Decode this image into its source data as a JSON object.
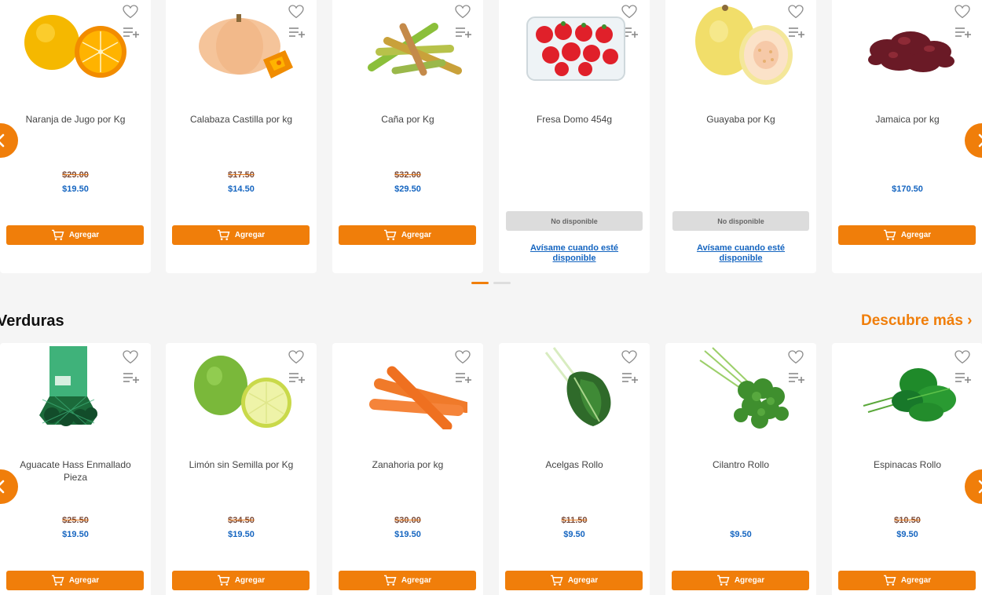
{
  "colors": {
    "accent": "#f07e0a",
    "price": "#1565c0",
    "unavailable": "#dcdcdc"
  },
  "icons": [
    "heart-icon",
    "list-add-icon",
    "cart-icon",
    "chevron-left-icon",
    "chevron-right-icon"
  ],
  "carousel1": {
    "products": [
      {
        "name": "Naranja de Jugo por Kg",
        "old_price": "$29.00",
        "price": "$19.50",
        "button": "Agregar"
      },
      {
        "name": "Calabaza Castilla por kg",
        "old_price": "$17.50",
        "price": "$14.50",
        "button": "Agregar"
      },
      {
        "name": "Caña por Kg",
        "old_price": "$32.00",
        "price": "$29.50",
        "button": "Agregar"
      },
      {
        "name": "Fresa Domo 454g",
        "unavailable": "No disponible",
        "notify_line1": "Avísame cuando esté",
        "notify_line2": "disponible"
      },
      {
        "name": "Guayaba por Kg",
        "unavailable": "No disponible",
        "notify_line1": "Avísame cuando esté",
        "notify_line2": "disponible"
      },
      {
        "name": "Jamaica por kg",
        "price": "$170.50",
        "button": "Agregar"
      }
    ]
  },
  "section2": {
    "title": "Verduras",
    "link": "Descubre más"
  },
  "carousel2": {
    "products": [
      {
        "name": "Aguacate Hass Enmallado Pieza",
        "old_price": "$25.50",
        "price": "$19.50",
        "button": "Agregar"
      },
      {
        "name": "Limón sin Semilla por Kg",
        "old_price": "$34.50",
        "price": "$19.50",
        "button": "Agregar"
      },
      {
        "name": "Zanahoria por kg",
        "old_price": "$30.00",
        "price": "$19.50",
        "button": "Agregar"
      },
      {
        "name": "Acelgas Rollo",
        "old_price": "$11.50",
        "price": "$9.50",
        "button": "Agregar"
      },
      {
        "name": "Cilantro Rollo",
        "price": "$9.50",
        "button": "Agregar"
      },
      {
        "name": "Espinacas Rollo",
        "old_price": "$10.50",
        "price": "$9.50",
        "button": "Agregar"
      }
    ]
  }
}
